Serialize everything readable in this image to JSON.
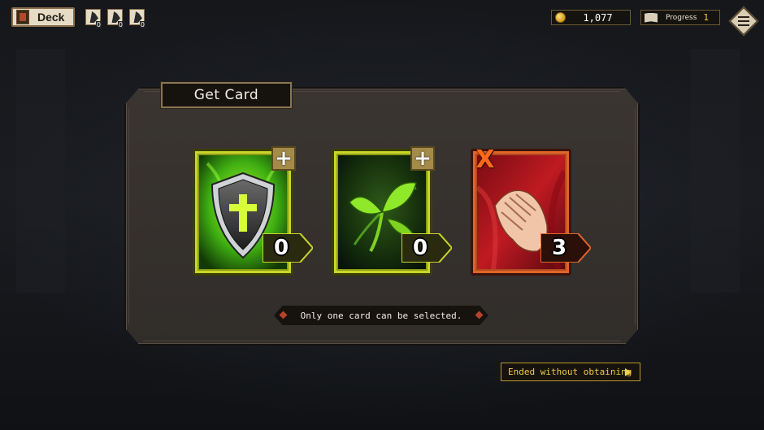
{
  "topbar": {
    "deck_label": "Deck",
    "mini_slots": [
      {
        "count": "0",
        "icon": "card-slot-icon"
      },
      {
        "count": "0",
        "icon": "card-slot-icon"
      },
      {
        "count": "0",
        "icon": "card-slot-icon"
      }
    ],
    "gold": "1,077",
    "progress_label": "Progress",
    "progress_value": "1",
    "menu_icon": "menu-list-icon"
  },
  "panel": {
    "title": "Get Card",
    "cards": [
      {
        "cost": "0",
        "badge": "+",
        "art": "shield-cross",
        "color": "#8b9c12"
      },
      {
        "cost": "0",
        "badge": "+",
        "art": "sprout-leaves",
        "color": "#8b9c12"
      },
      {
        "cost": "3",
        "badge": "X",
        "art": "clasped-hands",
        "color": "#b04a1c"
      }
    ],
    "hint": "Only one card can be selected."
  },
  "skip_button": "Ended without obtaining",
  "colors": {
    "accent_gold": "#f0cf4a",
    "green_card": "#8b9c12",
    "red_card": "#b04a1c"
  }
}
